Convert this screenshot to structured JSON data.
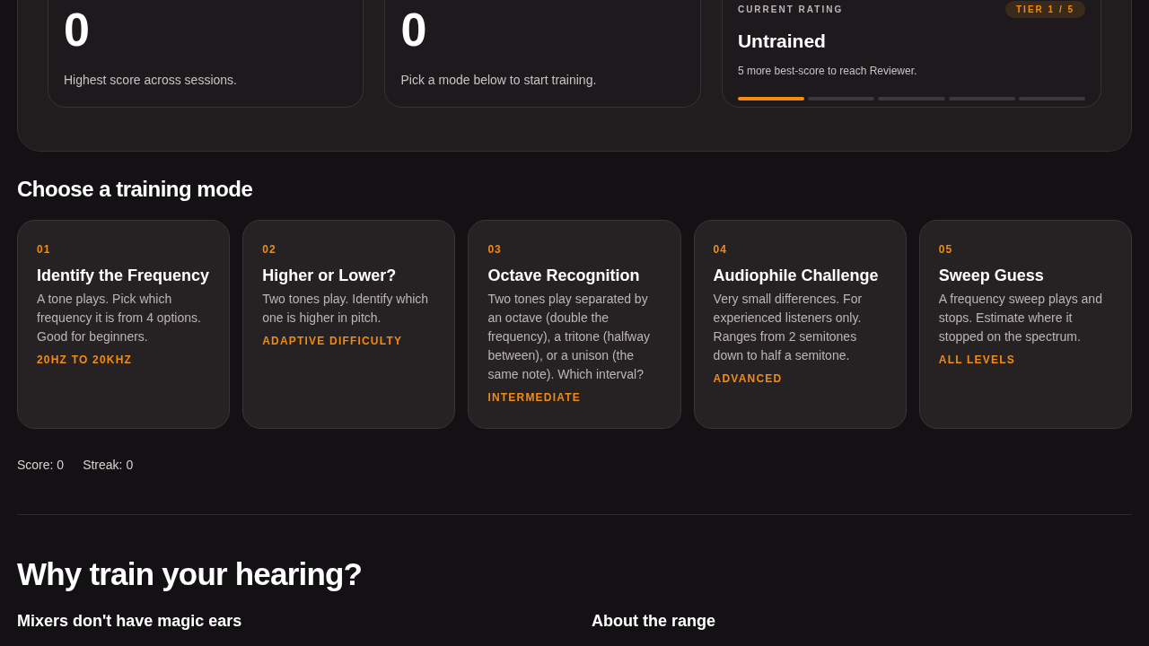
{
  "stats": [
    {
      "value": "0",
      "caption": "Highest score across sessions."
    },
    {
      "value": "0",
      "caption": "Pick a mode below to start training."
    }
  ],
  "rating": {
    "label": "CURRENT RATING",
    "badge": "TIER 1 / 5",
    "title": "Untrained",
    "caption": "5 more best-score to reach Reviewer.",
    "segments": [
      {
        "filled": true
      },
      {
        "filled": false
      },
      {
        "filled": false
      },
      {
        "filled": false
      },
      {
        "filled": false
      }
    ]
  },
  "modes_heading": "Choose a training mode",
  "modes": [
    {
      "number": "01",
      "title": "Identify the Frequency",
      "description": "A tone plays. Pick which frequency it is from 4 options. Good for beginners.",
      "tag": "20HZ TO 20KHZ"
    },
    {
      "number": "02",
      "title": "Higher or Lower?",
      "description": "Two tones play. Identify which one is higher in pitch.",
      "tag": "ADAPTIVE DIFFICULTY"
    },
    {
      "number": "03",
      "title": "Octave Recognition",
      "description": "Two tones play separated by an octave (double the frequency), a tritone (halfway between), or a unison (the same note). Which interval?",
      "tag": "INTERMEDIATE"
    },
    {
      "number": "04",
      "title": "Audiophile Challenge",
      "description": "Very small differences. For experienced listeners only. Ranges from 2 semitones down to half a semitone.",
      "tag": "ADVANCED"
    },
    {
      "number": "05",
      "title": "Sweep Guess",
      "description": "A frequency sweep plays and stops. Estimate where it stopped on the spectrum.",
      "tag": "ALL LEVELS"
    }
  ],
  "score": "Score: 0",
  "streak": "Streak: 0",
  "why_heading": "Why train your hearing?",
  "why_columns": [
    {
      "title": "Mixers don't have magic ears"
    },
    {
      "title": "About the range"
    }
  ]
}
